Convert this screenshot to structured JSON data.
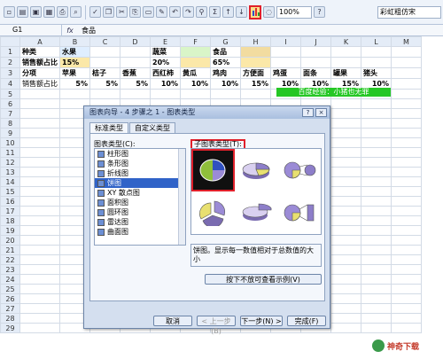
{
  "formula_bar": {
    "cell_ref": "G1",
    "fx": "fx",
    "value": "食品"
  },
  "toolbar": {
    "zoom": "100%",
    "font": "彩虹粗仿宋"
  },
  "columns": [
    "A",
    "B",
    "C",
    "D",
    "E",
    "F",
    "G",
    "H",
    "I",
    "J",
    "K",
    "L",
    "M"
  ],
  "rows": [
    [
      "1",
      "种类",
      "水果",
      "",
      "",
      "蔬菜",
      "",
      "食品",
      "",
      "",
      "",
      "",
      "",
      ""
    ],
    [
      "2",
      "销售额占比",
      "15%",
      "",
      "",
      "20%",
      "",
      "65%",
      "",
      "",
      "",
      "",
      "",
      ""
    ],
    [
      "3",
      "分项",
      "苹果",
      "桔子",
      "香蕉",
      "西红柿",
      "黄瓜",
      "鸡肉",
      "方便面",
      "鸡蛋",
      "面条",
      "罐果",
      "猪头",
      ""
    ],
    [
      "4",
      "销售额占比",
      "5%",
      "5%",
      "5%",
      "10%",
      "10%",
      "10%",
      "15%",
      "10%",
      "10%",
      "15%",
      "10%",
      ""
    ],
    [
      "5",
      "",
      "",
      "",
      "",
      "",
      "",
      "",
      "",
      "",
      "",
      "",
      "",
      ""
    ],
    [
      "6",
      "",
      "",
      "",
      "",
      "",
      "",
      "",
      "",
      "",
      "",
      "",
      "",
      ""
    ],
    [
      "7",
      "",
      "",
      "",
      "",
      "",
      "",
      "",
      "",
      "",
      "",
      "",
      "",
      ""
    ],
    [
      "8",
      "",
      "",
      "",
      "",
      "",
      "",
      "",
      "",
      "",
      "",
      "",
      "",
      ""
    ],
    [
      "9",
      "",
      "",
      "",
      "",
      "",
      "",
      "",
      "",
      "",
      "",
      "",
      "",
      ""
    ],
    [
      "10",
      "",
      "",
      "",
      "",
      "",
      "",
      "",
      "",
      "",
      "",
      "",
      "",
      ""
    ],
    [
      "11",
      "",
      "",
      "",
      "",
      "",
      "",
      "",
      "",
      "",
      "",
      "",
      "",
      ""
    ],
    [
      "12",
      "",
      "",
      "",
      "",
      "",
      "",
      "",
      "",
      "",
      "",
      "",
      "",
      ""
    ],
    [
      "13",
      "",
      "",
      "",
      "",
      "",
      "",
      "",
      "",
      "",
      "",
      "",
      "",
      ""
    ],
    [
      "14",
      "",
      "",
      "",
      "",
      "",
      "",
      "",
      "",
      "",
      "",
      "",
      "",
      ""
    ],
    [
      "15",
      "",
      "",
      "",
      "",
      "",
      "",
      "",
      "",
      "",
      "",
      "",
      "",
      ""
    ],
    [
      "16",
      "",
      "",
      "",
      "",
      "",
      "",
      "",
      "",
      "",
      "",
      "",
      "",
      ""
    ],
    [
      "17",
      "",
      "",
      "",
      "",
      "",
      "",
      "",
      "",
      "",
      "",
      "",
      "",
      ""
    ],
    [
      "18",
      "",
      "",
      "",
      "",
      "",
      "",
      "",
      "",
      "",
      "",
      "",
      "",
      ""
    ],
    [
      "19",
      "",
      "",
      "",
      "",
      "",
      "",
      "",
      "",
      "",
      "",
      "",
      "",
      ""
    ],
    [
      "20",
      "",
      "",
      "",
      "",
      "",
      "",
      "",
      "",
      "",
      "",
      "",
      "",
      ""
    ],
    [
      "21",
      "",
      "",
      "",
      "",
      "",
      "",
      "",
      "",
      "",
      "",
      "",
      "",
      ""
    ],
    [
      "22",
      "",
      "",
      "",
      "",
      "",
      "",
      "",
      "",
      "",
      "",
      "",
      "",
      ""
    ],
    [
      "23",
      "",
      "",
      "",
      "",
      "",
      "",
      "",
      "",
      "",
      "",
      "",
      "",
      ""
    ],
    [
      "24",
      "",
      "",
      "",
      "",
      "",
      "",
      "",
      "",
      "",
      "",
      "",
      "",
      ""
    ],
    [
      "25",
      "",
      "",
      "",
      "",
      "",
      "",
      "",
      "",
      "",
      "",
      "",
      "",
      ""
    ],
    [
      "26",
      "",
      "",
      "",
      "",
      "",
      "",
      "",
      "",
      "",
      "",
      "",
      "",
      ""
    ],
    [
      "27",
      "",
      "",
      "",
      "",
      "",
      "",
      "",
      "",
      "",
      "",
      "",
      "",
      ""
    ],
    [
      "28",
      "",
      "",
      "",
      "",
      "",
      "",
      "",
      "",
      "",
      "",
      "",
      "",
      ""
    ],
    [
      "29",
      "",
      "",
      "",
      "",
      "",
      "",
      "",
      "",
      "",
      "",
      "",
      "",
      ""
    ]
  ],
  "green_note": "百度经验：小猪也无罪",
  "dialog": {
    "title": "图表向导 - 4 步骤之 1 - 图表类型",
    "tabs": [
      "标准类型",
      "自定义类型"
    ],
    "chart_type_label": "图表类型(C):",
    "chart_types": [
      "柱形图",
      "条形图",
      "折线图",
      "饼图",
      "XY 散点图",
      "面积图",
      "圆环图",
      "雷达图",
      "曲面图"
    ],
    "selected_type": "饼图",
    "subtype_label": "子图表类型(T):",
    "description": "饼图。显示每一数值相对于总数值的大小",
    "hold_button": "按下不放可查看示例(V)",
    "buttons": {
      "cancel": "取消",
      "back": "< 上一步(B)",
      "next": "下一步(N) >",
      "finish": "完成(F)"
    }
  },
  "watermark": "神奇下载",
  "colors": {
    "header_fill": "#e4ecf7",
    "pie_dark": "#1a1a1a",
    "pie_green": "#8fbf3a",
    "pie_blue": "#3050c0",
    "pie_purple": "#9b8bd6",
    "highlight": "#e0202a"
  }
}
